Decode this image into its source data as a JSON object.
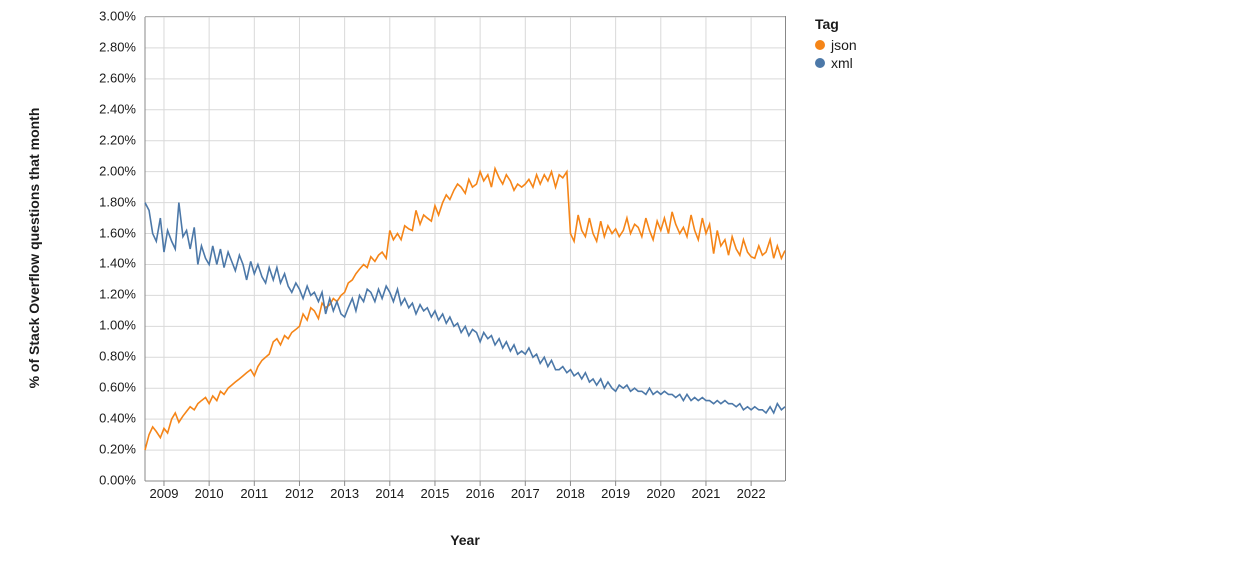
{
  "chart_data": {
    "type": "line",
    "title": "",
    "xlabel": "Year",
    "ylabel": "% of Stack Overflow questions that month",
    "xlim": [
      2008.58,
      2022.75
    ],
    "ylim": [
      0,
      3.0
    ],
    "x_ticks": [
      2009,
      2010,
      2011,
      2012,
      2013,
      2014,
      2015,
      2016,
      2017,
      2018,
      2019,
      2020,
      2021,
      2022
    ],
    "y_ticks": [
      0.0,
      0.2,
      0.4,
      0.6,
      0.8,
      1.0,
      1.2,
      1.4,
      1.6,
      1.8,
      2.0,
      2.2,
      2.4,
      2.6,
      2.8,
      3.0
    ],
    "y_tick_labels": [
      "0.00%",
      "0.20%",
      "0.40%",
      "0.60%",
      "0.80%",
      "1.00%",
      "1.20%",
      "1.40%",
      "1.60%",
      "1.80%",
      "2.00%",
      "2.20%",
      "2.40%",
      "2.60%",
      "2.80%",
      "3.00%"
    ],
    "legend_title": "Tag",
    "series": [
      {
        "name": "json",
        "color": "#f58518",
        "x": [
          2008.58,
          2008.67,
          2008.75,
          2008.83,
          2008.92,
          2009.0,
          2009.08,
          2009.17,
          2009.25,
          2009.33,
          2009.42,
          2009.5,
          2009.58,
          2009.67,
          2009.75,
          2009.83,
          2009.92,
          2010.0,
          2010.08,
          2010.17,
          2010.25,
          2010.33,
          2010.42,
          2010.5,
          2010.58,
          2010.67,
          2010.75,
          2010.83,
          2010.92,
          2011.0,
          2011.08,
          2011.17,
          2011.25,
          2011.33,
          2011.42,
          2011.5,
          2011.58,
          2011.67,
          2011.75,
          2011.83,
          2011.92,
          2012.0,
          2012.08,
          2012.17,
          2012.25,
          2012.33,
          2012.42,
          2012.5,
          2012.58,
          2012.67,
          2012.75,
          2012.83,
          2012.92,
          2013.0,
          2013.08,
          2013.17,
          2013.25,
          2013.33,
          2013.42,
          2013.5,
          2013.58,
          2013.67,
          2013.75,
          2013.83,
          2013.92,
          2014.0,
          2014.08,
          2014.17,
          2014.25,
          2014.33,
          2014.42,
          2014.5,
          2014.58,
          2014.67,
          2014.75,
          2014.83,
          2014.92,
          2015.0,
          2015.08,
          2015.17,
          2015.25,
          2015.33,
          2015.42,
          2015.5,
          2015.58,
          2015.67,
          2015.75,
          2015.83,
          2015.92,
          2016.0,
          2016.08,
          2016.17,
          2016.25,
          2016.33,
          2016.42,
          2016.5,
          2016.58,
          2016.67,
          2016.75,
          2016.83,
          2016.92,
          2017.0,
          2017.08,
          2017.17,
          2017.25,
          2017.33,
          2017.42,
          2017.5,
          2017.58,
          2017.67,
          2017.75,
          2017.83,
          2017.92,
          2018.0,
          2018.08,
          2018.17,
          2018.25,
          2018.33,
          2018.42,
          2018.5,
          2018.58,
          2018.67,
          2018.75,
          2018.83,
          2018.92,
          2019.0,
          2019.08,
          2019.17,
          2019.25,
          2019.33,
          2019.42,
          2019.5,
          2019.58,
          2019.67,
          2019.75,
          2019.83,
          2019.92,
          2020.0,
          2020.08,
          2020.17,
          2020.25,
          2020.33,
          2020.42,
          2020.5,
          2020.58,
          2020.67,
          2020.75,
          2020.83,
          2020.92,
          2021.0,
          2021.08,
          2021.17,
          2021.25,
          2021.33,
          2021.42,
          2021.5,
          2021.58,
          2021.67,
          2021.75,
          2021.83,
          2021.92,
          2022.0,
          2022.08,
          2022.17,
          2022.25,
          2022.33,
          2022.42,
          2022.5,
          2022.58,
          2022.67,
          2022.75
        ],
        "y": [
          0.2,
          0.3,
          0.35,
          0.32,
          0.28,
          0.34,
          0.31,
          0.4,
          0.44,
          0.38,
          0.42,
          0.45,
          0.48,
          0.46,
          0.5,
          0.52,
          0.54,
          0.5,
          0.55,
          0.52,
          0.58,
          0.56,
          0.6,
          0.62,
          0.64,
          0.66,
          0.68,
          0.7,
          0.72,
          0.68,
          0.74,
          0.78,
          0.8,
          0.82,
          0.9,
          0.92,
          0.88,
          0.94,
          0.92,
          0.96,
          0.98,
          1.0,
          1.08,
          1.04,
          1.12,
          1.1,
          1.05,
          1.15,
          1.12,
          1.14,
          1.18,
          1.16,
          1.2,
          1.22,
          1.28,
          1.3,
          1.34,
          1.37,
          1.4,
          1.38,
          1.45,
          1.42,
          1.46,
          1.48,
          1.44,
          1.62,
          1.56,
          1.6,
          1.56,
          1.65,
          1.63,
          1.62,
          1.75,
          1.66,
          1.72,
          1.7,
          1.68,
          1.78,
          1.72,
          1.8,
          1.85,
          1.82,
          1.88,
          1.92,
          1.9,
          1.86,
          1.95,
          1.9,
          1.92,
          2.0,
          1.94,
          1.98,
          1.9,
          2.02,
          1.96,
          1.92,
          1.98,
          1.94,
          1.88,
          1.92,
          1.9,
          1.92,
          1.95,
          1.9,
          1.98,
          1.92,
          1.98,
          1.94,
          2.0,
          1.9,
          1.98,
          1.96,
          2.0,
          1.6,
          1.55,
          1.72,
          1.62,
          1.58,
          1.7,
          1.6,
          1.55,
          1.68,
          1.58,
          1.65,
          1.6,
          1.63,
          1.58,
          1.62,
          1.7,
          1.6,
          1.66,
          1.64,
          1.58,
          1.7,
          1.62,
          1.56,
          1.68,
          1.62,
          1.7,
          1.6,
          1.74,
          1.66,
          1.6,
          1.64,
          1.58,
          1.72,
          1.62,
          1.56,
          1.7,
          1.6,
          1.66,
          1.47,
          1.62,
          1.52,
          1.56,
          1.46,
          1.58,
          1.5,
          1.46,
          1.56,
          1.48,
          1.45,
          1.44,
          1.52,
          1.46,
          1.48,
          1.56,
          1.44,
          1.52,
          1.44,
          1.49
        ]
      },
      {
        "name": "xml",
        "color": "#4c78a8",
        "x": [
          2008.58,
          2008.67,
          2008.75,
          2008.83,
          2008.92,
          2009.0,
          2009.08,
          2009.17,
          2009.25,
          2009.33,
          2009.42,
          2009.5,
          2009.58,
          2009.67,
          2009.75,
          2009.83,
          2009.92,
          2010.0,
          2010.08,
          2010.17,
          2010.25,
          2010.33,
          2010.42,
          2010.5,
          2010.58,
          2010.67,
          2010.75,
          2010.83,
          2010.92,
          2011.0,
          2011.08,
          2011.17,
          2011.25,
          2011.33,
          2011.42,
          2011.5,
          2011.58,
          2011.67,
          2011.75,
          2011.83,
          2011.92,
          2012.0,
          2012.08,
          2012.17,
          2012.25,
          2012.33,
          2012.42,
          2012.5,
          2012.58,
          2012.67,
          2012.75,
          2012.83,
          2012.92,
          2013.0,
          2013.08,
          2013.17,
          2013.25,
          2013.33,
          2013.42,
          2013.5,
          2013.58,
          2013.67,
          2013.75,
          2013.83,
          2013.92,
          2014.0,
          2014.08,
          2014.17,
          2014.25,
          2014.33,
          2014.42,
          2014.5,
          2014.58,
          2014.67,
          2014.75,
          2014.83,
          2014.92,
          2015.0,
          2015.08,
          2015.17,
          2015.25,
          2015.33,
          2015.42,
          2015.5,
          2015.58,
          2015.67,
          2015.75,
          2015.83,
          2015.92,
          2016.0,
          2016.08,
          2016.17,
          2016.25,
          2016.33,
          2016.42,
          2016.5,
          2016.58,
          2016.67,
          2016.75,
          2016.83,
          2016.92,
          2017.0,
          2017.08,
          2017.17,
          2017.25,
          2017.33,
          2017.42,
          2017.5,
          2017.58,
          2017.67,
          2017.75,
          2017.83,
          2017.92,
          2018.0,
          2018.08,
          2018.17,
          2018.25,
          2018.33,
          2018.42,
          2018.5,
          2018.58,
          2018.67,
          2018.75,
          2018.83,
          2018.92,
          2019.0,
          2019.08,
          2019.17,
          2019.25,
          2019.33,
          2019.42,
          2019.5,
          2019.58,
          2019.67,
          2019.75,
          2019.83,
          2019.92,
          2020.0,
          2020.08,
          2020.17,
          2020.25,
          2020.33,
          2020.42,
          2020.5,
          2020.58,
          2020.67,
          2020.75,
          2020.83,
          2020.92,
          2021.0,
          2021.08,
          2021.17,
          2021.25,
          2021.33,
          2021.42,
          2021.5,
          2021.58,
          2021.67,
          2021.75,
          2021.83,
          2021.92,
          2022.0,
          2022.08,
          2022.17,
          2022.25,
          2022.33,
          2022.42,
          2022.5,
          2022.58,
          2022.67,
          2022.75
        ],
        "y": [
          1.8,
          1.75,
          1.6,
          1.55,
          1.7,
          1.48,
          1.62,
          1.55,
          1.5,
          1.8,
          1.58,
          1.62,
          1.5,
          1.64,
          1.4,
          1.52,
          1.44,
          1.4,
          1.52,
          1.4,
          1.5,
          1.38,
          1.48,
          1.42,
          1.36,
          1.46,
          1.4,
          1.3,
          1.42,
          1.34,
          1.4,
          1.32,
          1.28,
          1.38,
          1.3,
          1.38,
          1.28,
          1.34,
          1.26,
          1.22,
          1.28,
          1.24,
          1.18,
          1.26,
          1.2,
          1.22,
          1.16,
          1.22,
          1.08,
          1.18,
          1.1,
          1.16,
          1.08,
          1.06,
          1.12,
          1.18,
          1.1,
          1.2,
          1.16,
          1.24,
          1.22,
          1.16,
          1.24,
          1.18,
          1.26,
          1.22,
          1.16,
          1.24,
          1.14,
          1.18,
          1.12,
          1.15,
          1.08,
          1.14,
          1.1,
          1.12,
          1.06,
          1.1,
          1.04,
          1.08,
          1.02,
          1.06,
          1.0,
          1.02,
          0.96,
          1.0,
          0.94,
          0.98,
          0.96,
          0.9,
          0.96,
          0.92,
          0.94,
          0.88,
          0.92,
          0.86,
          0.9,
          0.84,
          0.88,
          0.82,
          0.84,
          0.82,
          0.86,
          0.8,
          0.82,
          0.76,
          0.8,
          0.74,
          0.78,
          0.72,
          0.72,
          0.74,
          0.7,
          0.72,
          0.68,
          0.7,
          0.66,
          0.7,
          0.64,
          0.66,
          0.62,
          0.66,
          0.6,
          0.64,
          0.6,
          0.58,
          0.62,
          0.6,
          0.62,
          0.58,
          0.6,
          0.58,
          0.58,
          0.56,
          0.6,
          0.56,
          0.58,
          0.56,
          0.58,
          0.56,
          0.56,
          0.54,
          0.56,
          0.52,
          0.56,
          0.52,
          0.54,
          0.52,
          0.54,
          0.52,
          0.52,
          0.5,
          0.52,
          0.5,
          0.52,
          0.5,
          0.5,
          0.48,
          0.5,
          0.46,
          0.48,
          0.46,
          0.48,
          0.46,
          0.46,
          0.44,
          0.48,
          0.44,
          0.5,
          0.46,
          0.48
        ]
      }
    ]
  }
}
